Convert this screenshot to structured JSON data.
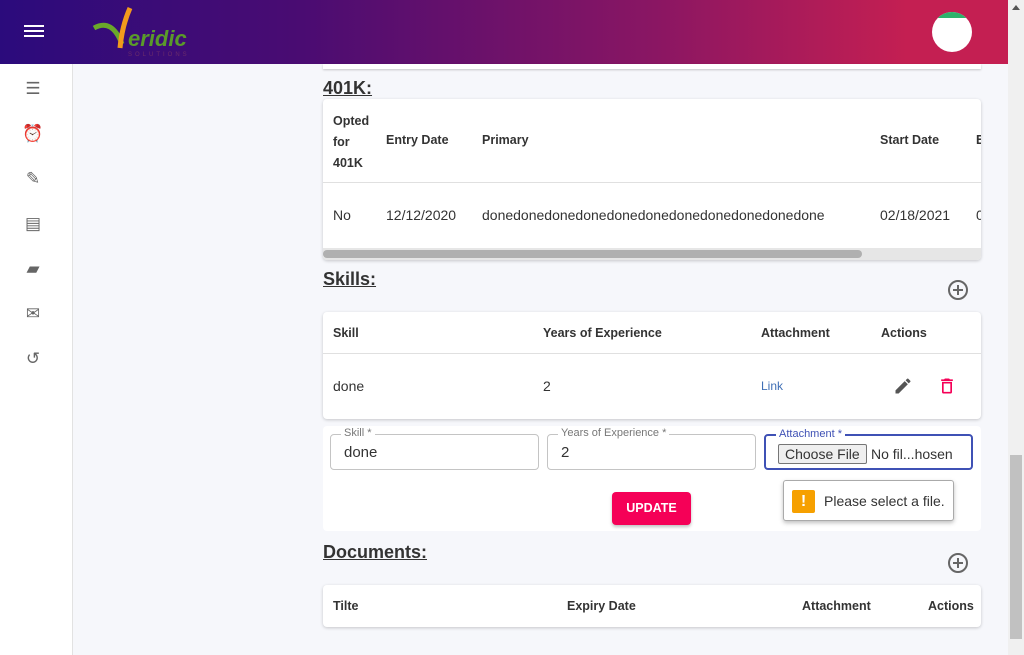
{
  "header": {
    "logo_text": "Veridic",
    "logo_sub": "SOLUTIONS"
  },
  "sidebar": {
    "items": [
      "checklist-icon",
      "alarm-icon",
      "payments-icon",
      "document-icon",
      "chat-icon",
      "inbox-icon",
      "history-icon"
    ]
  },
  "k401": {
    "title": "401K:",
    "headers": [
      "Opted for 401K",
      "Entry Date",
      "Primary",
      "Start Date",
      "E"
    ],
    "row": [
      "No",
      "12/12/2020",
      "donedonedonedonedonedonedonedonedonedonedone",
      "02/18/2021",
      "0"
    ]
  },
  "skills": {
    "title": "Skills:",
    "headers": [
      "Skill",
      "Years of Experience",
      "Attachment",
      "Actions"
    ],
    "row": {
      "skill": "done",
      "years": "2",
      "attachment": "Link"
    },
    "form": {
      "skill_label": "Skill *",
      "skill_value": "done",
      "years_label": "Years of Experience *",
      "years_value": "2",
      "attachment_label": "Attachment *",
      "choose_file": "Choose File",
      "no_file": "No fil...hosen",
      "update": "UPDATE",
      "tooltip": "Please select a file."
    }
  },
  "documents": {
    "title": "Documents:",
    "headers": [
      "Tilte",
      "Expiry Date",
      "Attachment",
      "Actions"
    ]
  },
  "colors": {
    "accent": "#f50057",
    "primary": "#3f51b5"
  }
}
